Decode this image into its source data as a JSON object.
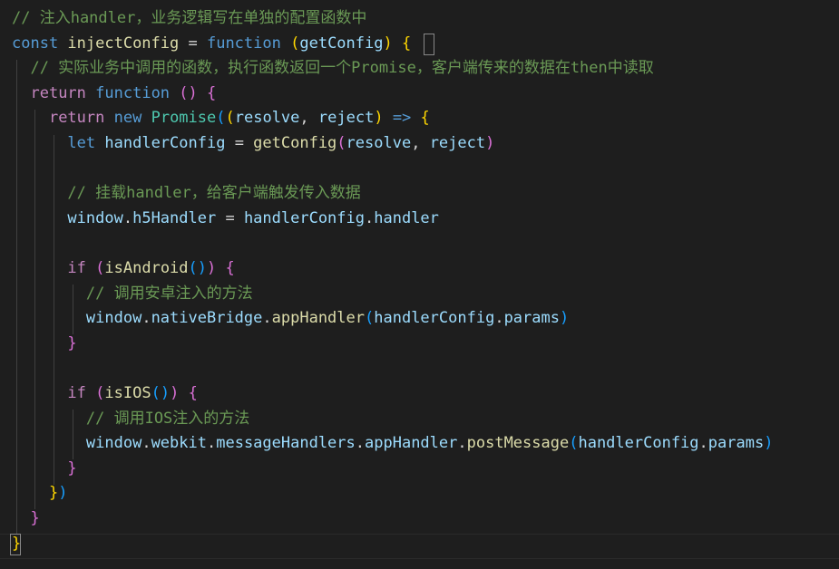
{
  "colors": {
    "background": "#1e1e1e",
    "comment": "#6a9955",
    "keyword": "#569cd6",
    "control": "#c586c0",
    "function": "#dcdcaa",
    "variable": "#9cdcfe",
    "class": "#4ec9b0",
    "text": "#d4d4d4",
    "bracket1": "#ffd700",
    "bracket2": "#da70d6",
    "bracket3": "#179fff"
  },
  "code": {
    "lines": [
      [
        {
          "t": "// 注入handler，业务逻辑写在单独的配置函数中",
          "c": "comment"
        }
      ],
      [
        {
          "t": "const ",
          "c": "keyword"
        },
        {
          "t": "injectConfig",
          "c": "function"
        },
        {
          "t": " = ",
          "c": "text"
        },
        {
          "t": "function",
          "c": "keyword"
        },
        {
          "t": " ",
          "c": "text"
        },
        {
          "t": "(",
          "c": "bracket1"
        },
        {
          "t": "getConfig",
          "c": "variable"
        },
        {
          "t": ")",
          "c": "bracket1"
        },
        {
          "t": " ",
          "c": "text"
        },
        {
          "t": "{",
          "c": "bracket1"
        }
      ],
      [
        {
          "t": "  // 实际业务中调用的函数，执行函数返回一个Promise，客户端传来的数据在then中读取",
          "c": "comment"
        }
      ],
      [
        {
          "t": "  ",
          "c": "text"
        },
        {
          "t": "return",
          "c": "control"
        },
        {
          "t": " ",
          "c": "text"
        },
        {
          "t": "function",
          "c": "keyword"
        },
        {
          "t": " ",
          "c": "text"
        },
        {
          "t": "()",
          "c": "bracket2"
        },
        {
          "t": " ",
          "c": "text"
        },
        {
          "t": "{",
          "c": "bracket2"
        }
      ],
      [
        {
          "t": "    ",
          "c": "text"
        },
        {
          "t": "return",
          "c": "control"
        },
        {
          "t": " ",
          "c": "text"
        },
        {
          "t": "new",
          "c": "keyword"
        },
        {
          "t": " ",
          "c": "text"
        },
        {
          "t": "Promise",
          "c": "class"
        },
        {
          "t": "(",
          "c": "bracket3"
        },
        {
          "t": "(",
          "c": "bracket1"
        },
        {
          "t": "resolve",
          "c": "variable"
        },
        {
          "t": ", ",
          "c": "text"
        },
        {
          "t": "reject",
          "c": "variable"
        },
        {
          "t": ")",
          "c": "bracket1"
        },
        {
          "t": " ",
          "c": "text"
        },
        {
          "t": "=>",
          "c": "keyword"
        },
        {
          "t": " ",
          "c": "text"
        },
        {
          "t": "{",
          "c": "bracket1"
        }
      ],
      [
        {
          "t": "      ",
          "c": "text"
        },
        {
          "t": "let",
          "c": "keyword"
        },
        {
          "t": " ",
          "c": "text"
        },
        {
          "t": "handlerConfig",
          "c": "variable"
        },
        {
          "t": " = ",
          "c": "text"
        },
        {
          "t": "getConfig",
          "c": "function"
        },
        {
          "t": "(",
          "c": "bracket2"
        },
        {
          "t": "resolve",
          "c": "variable"
        },
        {
          "t": ", ",
          "c": "text"
        },
        {
          "t": "reject",
          "c": "variable"
        },
        {
          "t": ")",
          "c": "bracket2"
        }
      ],
      [],
      [
        {
          "t": "      // 挂载handler，给客户端触发传入数据",
          "c": "comment"
        }
      ],
      [
        {
          "t": "      ",
          "c": "text"
        },
        {
          "t": "window",
          "c": "variable"
        },
        {
          "t": ".",
          "c": "text"
        },
        {
          "t": "h5Handler",
          "c": "variable"
        },
        {
          "t": " = ",
          "c": "text"
        },
        {
          "t": "handlerConfig",
          "c": "variable"
        },
        {
          "t": ".",
          "c": "text"
        },
        {
          "t": "handler",
          "c": "variable"
        }
      ],
      [],
      [
        {
          "t": "      ",
          "c": "text"
        },
        {
          "t": "if",
          "c": "control"
        },
        {
          "t": " ",
          "c": "text"
        },
        {
          "t": "(",
          "c": "bracket2"
        },
        {
          "t": "isAndroid",
          "c": "function"
        },
        {
          "t": "()",
          "c": "bracket3"
        },
        {
          "t": ")",
          "c": "bracket2"
        },
        {
          "t": " ",
          "c": "text"
        },
        {
          "t": "{",
          "c": "bracket2"
        }
      ],
      [
        {
          "t": "        // 调用安卓注入的方法",
          "c": "comment"
        }
      ],
      [
        {
          "t": "        ",
          "c": "text"
        },
        {
          "t": "window",
          "c": "variable"
        },
        {
          "t": ".",
          "c": "text"
        },
        {
          "t": "nativeBridge",
          "c": "variable"
        },
        {
          "t": ".",
          "c": "text"
        },
        {
          "t": "appHandler",
          "c": "function"
        },
        {
          "t": "(",
          "c": "bracket3"
        },
        {
          "t": "handlerConfig",
          "c": "variable"
        },
        {
          "t": ".",
          "c": "text"
        },
        {
          "t": "params",
          "c": "variable"
        },
        {
          "t": ")",
          "c": "bracket3"
        }
      ],
      [
        {
          "t": "      ",
          "c": "text"
        },
        {
          "t": "}",
          "c": "bracket2"
        }
      ],
      [],
      [
        {
          "t": "      ",
          "c": "text"
        },
        {
          "t": "if",
          "c": "control"
        },
        {
          "t": " ",
          "c": "text"
        },
        {
          "t": "(",
          "c": "bracket2"
        },
        {
          "t": "isIOS",
          "c": "function"
        },
        {
          "t": "()",
          "c": "bracket3"
        },
        {
          "t": ")",
          "c": "bracket2"
        },
        {
          "t": " ",
          "c": "text"
        },
        {
          "t": "{",
          "c": "bracket2"
        }
      ],
      [
        {
          "t": "        // 调用IOS注入的方法",
          "c": "comment"
        }
      ],
      [
        {
          "t": "        ",
          "c": "text"
        },
        {
          "t": "window",
          "c": "variable"
        },
        {
          "t": ".",
          "c": "text"
        },
        {
          "t": "webkit",
          "c": "variable"
        },
        {
          "t": ".",
          "c": "text"
        },
        {
          "t": "messageHandlers",
          "c": "variable"
        },
        {
          "t": ".",
          "c": "text"
        },
        {
          "t": "appHandler",
          "c": "variable"
        },
        {
          "t": ".",
          "c": "text"
        },
        {
          "t": "postMessage",
          "c": "function"
        },
        {
          "t": "(",
          "c": "bracket3"
        },
        {
          "t": "handlerConfig",
          "c": "variable"
        },
        {
          "t": ".",
          "c": "text"
        },
        {
          "t": "params",
          "c": "variable"
        },
        {
          "t": ")",
          "c": "bracket3"
        }
      ],
      [
        {
          "t": "      ",
          "c": "text"
        },
        {
          "t": "}",
          "c": "bracket2"
        }
      ],
      [
        {
          "t": "    ",
          "c": "text"
        },
        {
          "t": "}",
          "c": "bracket1"
        },
        {
          "t": ")",
          "c": "bracket3"
        }
      ],
      [
        {
          "t": "  ",
          "c": "text"
        },
        {
          "t": "}",
          "c": "bracket2"
        }
      ],
      [
        {
          "t": "}",
          "c": "bracket1"
        }
      ]
    ]
  }
}
